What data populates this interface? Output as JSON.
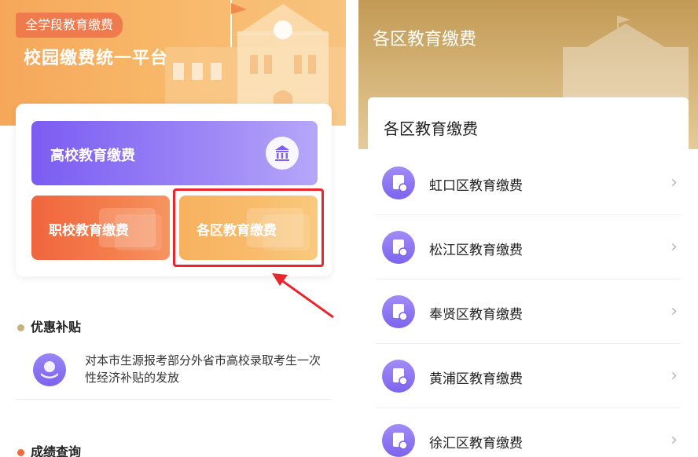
{
  "left": {
    "tag": "全学段教育缴费",
    "banner_title": "校园缴费统一平台",
    "tiles": {
      "university": "高校教育缴费",
      "vocational": "职校教育缴费",
      "district": "各区教育缴费"
    },
    "sections": {
      "subsidy_title": "优惠补贴",
      "subsidy_text": "对本市生源报考部分外省市高校录取考生一次性经济补贴的发放",
      "grades_title": "成绩查询"
    }
  },
  "right": {
    "header_title": "各区教育缴费",
    "card_title": "各区教育缴费",
    "items": [
      {
        "label": "虹口区教育缴费"
      },
      {
        "label": "松江区教育缴费"
      },
      {
        "label": "奉贤区教育缴费"
      },
      {
        "label": "黄浦区教育缴费"
      },
      {
        "label": "徐汇区教育缴费"
      }
    ]
  },
  "colors": {
    "accent_purple": "#7b5cf2",
    "accent_orange": "#f0653d",
    "accent_yellow": "#f7b15e",
    "highlight_red": "#e8262c",
    "banner_gold": "#c29a55"
  },
  "icons": {
    "bank": "bank-icon",
    "subsidy": "hand-coin-icon",
    "district_item": "document-icon",
    "chevron": "chevron-right-icon"
  }
}
